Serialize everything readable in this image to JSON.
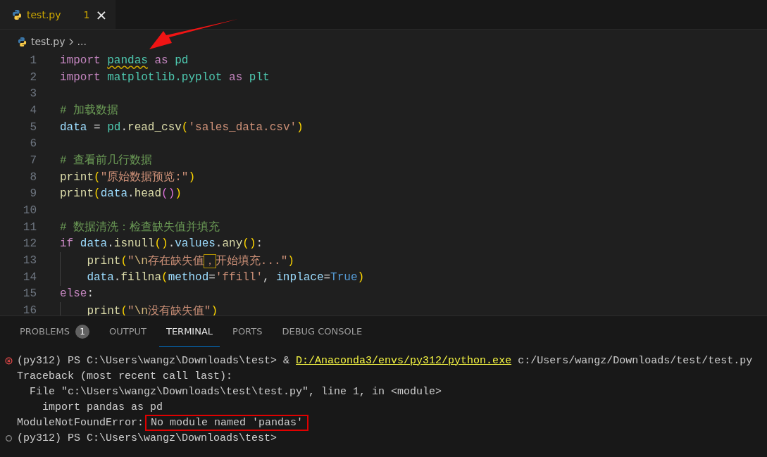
{
  "editor_tabs": [
    {
      "label": "test.py",
      "problem_count": "1",
      "close": "×",
      "selected": true
    }
  ],
  "breadcrumb": {
    "file": "test.py",
    "more": "..."
  },
  "code": [
    {
      "number": "1",
      "tokens": [
        {
          "kind": "kw",
          "text": "import "
        },
        {
          "kind": "mod",
          "text": "pandas",
          "squiggle": true
        },
        {
          "kind": "kw",
          "text": " as "
        },
        {
          "kind": "mod",
          "text": "pd"
        }
      ]
    },
    {
      "number": "2",
      "tokens": [
        {
          "kind": "kw",
          "text": "import "
        },
        {
          "kind": "mod",
          "text": "matplotlib.pyplot"
        },
        {
          "kind": "kw",
          "text": " as "
        },
        {
          "kind": "mod",
          "text": "plt"
        }
      ]
    },
    {
      "number": "3"
    },
    {
      "number": "4",
      "tokens": [
        {
          "kind": "cmt",
          "text": "# 加载数据"
        }
      ]
    },
    {
      "number": "5",
      "tokens": [
        {
          "kind": "var",
          "text": "data"
        },
        {
          "kind": "plain",
          "text": " = "
        },
        {
          "kind": "mod",
          "text": "pd"
        },
        {
          "kind": "plain",
          "text": "."
        },
        {
          "kind": "fn",
          "text": "read_csv"
        },
        {
          "kind": "p1",
          "text": "("
        },
        {
          "kind": "str",
          "text": "'sales_data.csv'"
        },
        {
          "kind": "p1",
          "text": ")"
        }
      ]
    },
    {
      "number": "6"
    },
    {
      "number": "7",
      "tokens": [
        {
          "kind": "cmt",
          "text": "# 查看前几行数据"
        }
      ]
    },
    {
      "number": "8",
      "tokens": [
        {
          "kind": "fn",
          "text": "print"
        },
        {
          "kind": "p1",
          "text": "("
        },
        {
          "kind": "str",
          "text": "\"原始数据预览:\""
        },
        {
          "kind": "p1",
          "text": ")"
        }
      ]
    },
    {
      "number": "9",
      "tokens": [
        {
          "kind": "fn",
          "text": "print"
        },
        {
          "kind": "p1",
          "text": "("
        },
        {
          "kind": "var",
          "text": "data"
        },
        {
          "kind": "plain",
          "text": "."
        },
        {
          "kind": "fn",
          "text": "head"
        },
        {
          "kind": "p2",
          "text": "()"
        },
        {
          "kind": "p1",
          "text": ")"
        }
      ]
    },
    {
      "number": "10"
    },
    {
      "number": "11",
      "tokens": [
        {
          "kind": "cmt",
          "text": "# 数据清洗：检查缺失值并填充"
        }
      ]
    },
    {
      "number": "12",
      "tokens": [
        {
          "kind": "kw",
          "text": "if "
        },
        {
          "kind": "var",
          "text": "data"
        },
        {
          "kind": "plain",
          "text": "."
        },
        {
          "kind": "fn",
          "text": "isnull"
        },
        {
          "kind": "p1",
          "text": "()"
        },
        {
          "kind": "plain",
          "text": "."
        },
        {
          "kind": "var",
          "text": "values"
        },
        {
          "kind": "plain",
          "text": "."
        },
        {
          "kind": "fn",
          "text": "any"
        },
        {
          "kind": "p1",
          "text": "()"
        },
        {
          "kind": "plain",
          "text": ":"
        }
      ],
      "children": [
        {
          "number": "13",
          "tokens": [
            {
              "kind": "fn",
              "text": "print"
            },
            {
              "kind": "p1",
              "text": "("
            },
            {
              "kind": "str",
              "text": "\""
            },
            {
              "kind": "esc",
              "text": "\\n"
            },
            {
              "kind": "str",
              "text": "存在缺失值"
            },
            {
              "kind": "str",
              "text": "，",
              "boxed": true
            },
            {
              "kind": "str",
              "text": "开始填充...\""
            },
            {
              "kind": "p1",
              "text": ")"
            }
          ]
        },
        {
          "number": "14",
          "tokens": [
            {
              "kind": "var",
              "text": "data"
            },
            {
              "kind": "plain",
              "text": "."
            },
            {
              "kind": "fn",
              "text": "fillna"
            },
            {
              "kind": "p1",
              "text": "("
            },
            {
              "kind": "var",
              "text": "method"
            },
            {
              "kind": "plain",
              "text": "="
            },
            {
              "kind": "str",
              "text": "'ffill'"
            },
            {
              "kind": "plain",
              "text": ", "
            },
            {
              "kind": "var",
              "text": "inplace"
            },
            {
              "kind": "plain",
              "text": "="
            },
            {
              "kind": "const",
              "text": "True"
            },
            {
              "kind": "p1",
              "text": ")"
            }
          ]
        }
      ]
    },
    {
      "number": "15",
      "tokens": [
        {
          "kind": "kw",
          "text": "else"
        },
        {
          "kind": "plain",
          "text": ":"
        }
      ],
      "children": [
        {
          "number": "16",
          "tokens": [
            {
              "kind": "fn",
              "text": "print"
            },
            {
              "kind": "p1",
              "text": "("
            },
            {
              "kind": "str",
              "text": "\""
            },
            {
              "kind": "esc",
              "text": "\\n"
            },
            {
              "kind": "str",
              "text": "没有缺失值\""
            },
            {
              "kind": "p1",
              "text": ")"
            }
          ]
        }
      ]
    }
  ],
  "panel_tabs": [
    {
      "label": "PROBLEMS",
      "badge": "1",
      "selected": false
    },
    {
      "label": "OUTPUT",
      "selected": false
    },
    {
      "label": "TERMINAL",
      "selected": true
    },
    {
      "label": "PORTS",
      "selected": false
    },
    {
      "label": "DEBUG CONSOLE",
      "selected": false
    }
  ],
  "terminal": [
    {
      "failed": true,
      "parts": [
        {
          "kind": "plain",
          "text": "(py312) PS C:\\Users\\wangz\\Downloads\\test> & "
        },
        {
          "kind": "link",
          "text": "D:/Anaconda3/envs/py312/python.exe"
        },
        {
          "kind": "plain",
          "text": " c:/Users/wangz/Downloads/test/test.py"
        }
      ]
    },
    {
      "parts": [
        {
          "kind": "plain",
          "text": "Traceback (most recent call last):"
        }
      ]
    },
    {
      "parts": [
        {
          "kind": "plain",
          "text": "  File \"c:\\Users\\wangz\\Downloads\\test\\test.py\", line 1, in <module>"
        }
      ]
    },
    {
      "parts": [
        {
          "kind": "plain",
          "text": "    import pandas as pd"
        }
      ]
    },
    {
      "parts": [
        {
          "kind": "plain",
          "text": "ModuleNotFoundError:"
        },
        {
          "kind": "boxed",
          "text": "No module named 'pandas'"
        }
      ]
    },
    {
      "failed": false,
      "parts": [
        {
          "kind": "plain",
          "text": "(py312) PS C:\\Users\\wangz\\Downloads\\test>"
        }
      ]
    }
  ]
}
